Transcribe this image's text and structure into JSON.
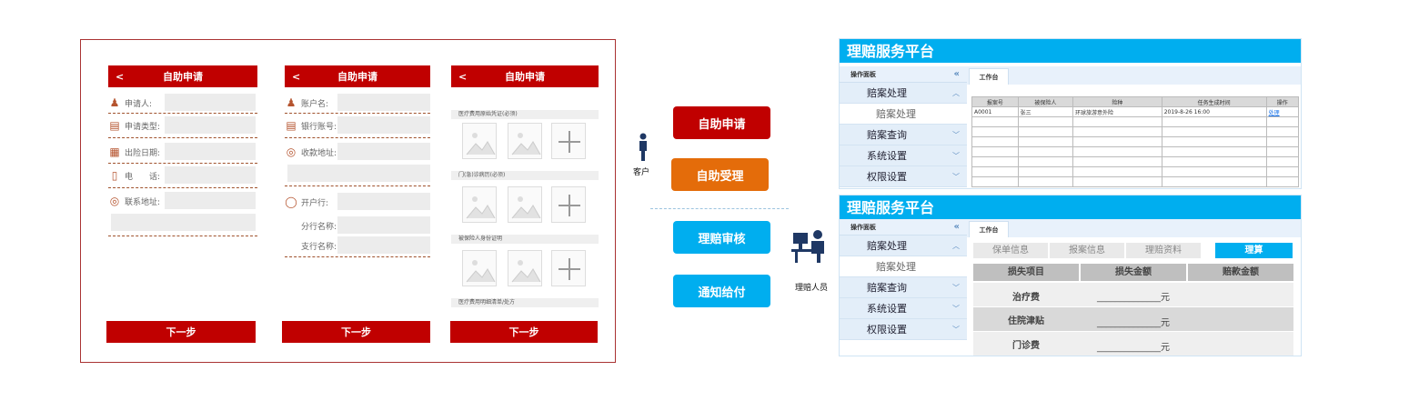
{
  "mobile": {
    "header_title": "自助申请",
    "back": "<",
    "next_label": "下一步",
    "form1": [
      {
        "label": "申请人:",
        "icon": "person-icon"
      },
      {
        "label": "申请类型:",
        "icon": "document-icon"
      },
      {
        "label": "出险日期:",
        "icon": "calendar-icon"
      },
      {
        "label": "电　　话:",
        "icon": "phone-icon"
      },
      {
        "label": "联系地址:",
        "icon": "globe-icon"
      }
    ],
    "form2": [
      {
        "label": "账户名:",
        "icon": "person-icon"
      },
      {
        "label": "银行账号:",
        "icon": "document-icon"
      },
      {
        "label": "收款地址:",
        "icon": "globe-icon"
      },
      {
        "label": "开户行:",
        "icon": "coins-icon"
      },
      {
        "label": "分行名称:",
        "icon": ""
      },
      {
        "label": "支行名称:",
        "icon": ""
      }
    ],
    "form3_sections": [
      "医疗费用原始凭证(必须)",
      "门(急)诊病历(必须)",
      "被保险人身份证明",
      "医疗费用明细清单/处方"
    ]
  },
  "center": {
    "buttons": [
      {
        "label": "自助申请",
        "color": "#c00000"
      },
      {
        "label": "自助受理",
        "color": "#e46c0a"
      },
      {
        "label": "理赔审核",
        "color": "#00aeef"
      },
      {
        "label": "通知给付",
        "color": "#00aeef"
      }
    ],
    "customer_label": "客户",
    "staff_label": "理赔人员"
  },
  "platform": {
    "title": "理赔服务平台",
    "panel_label": "操作面板",
    "tab_label": "工作台",
    "menu": [
      "赔案处理",
      "赔案处理",
      "赔案查询",
      "系统设置",
      "权限设置"
    ],
    "table_headers": [
      "报案号",
      "被保险人",
      "险种",
      "任务生成时间",
      "操作"
    ],
    "table_rows": [
      [
        "A0001",
        "张三",
        "环球旅游意外险",
        "2019-8-26 16:00",
        "处理"
      ]
    ],
    "subtabs": [
      "保单信息",
      "报案信息",
      "理赔资料",
      "理算"
    ],
    "loss_headers": [
      "损失项目",
      "损失金额",
      "赔款金额"
    ],
    "loss_rows": [
      {
        "item": "治疗费",
        "amount": "______________元"
      },
      {
        "item": "住院津贴",
        "amount": "______________元"
      },
      {
        "item": "门诊费",
        "amount": "______________元"
      }
    ],
    "colors": {
      "brand_blue": "#00aeef",
      "brand_red": "#c00000"
    }
  }
}
